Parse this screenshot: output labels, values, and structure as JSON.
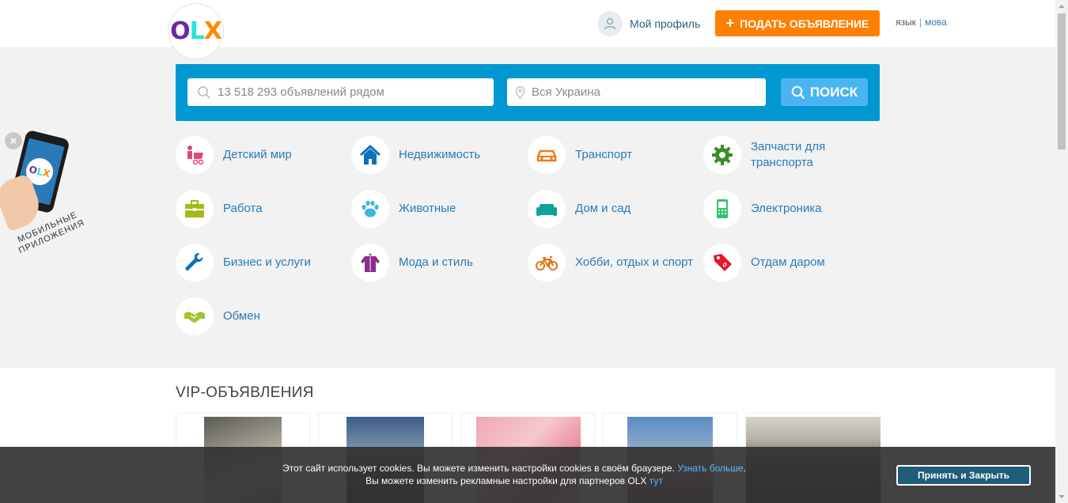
{
  "header": {
    "logo": {
      "o": "O",
      "l": "L",
      "x": "X"
    },
    "profile_label": "Мой профиль",
    "post_button": "ПОДАТЬ ОБЪЯВЛЕНИЕ",
    "lang_current": "язык",
    "lang_separator": "|",
    "lang_alt": "мова"
  },
  "search": {
    "placeholder": "13 518 293 объявлений рядом",
    "location_placeholder": "Вся Украина",
    "button_label": "ПОИСК"
  },
  "categories": [
    {
      "label": "Детский мир",
      "icon": "stroller-icon",
      "color": "#e0457b"
    },
    {
      "label": "Недвижимость",
      "icon": "house-icon",
      "color": "#0a72ba"
    },
    {
      "label": "Транспорт",
      "icon": "car-icon",
      "color": "#f07a15"
    },
    {
      "label": "Запчасти для транспорта",
      "icon": "gear-icon",
      "color": "#3c8c2c"
    },
    {
      "label": "Работа",
      "icon": "briefcase-icon",
      "color": "#a5b818"
    },
    {
      "label": "Животные",
      "icon": "paw-icon",
      "color": "#3ab6e6"
    },
    {
      "label": "Дом и сад",
      "icon": "sofa-icon",
      "color": "#0fa19a"
    },
    {
      "label": "Электроника",
      "icon": "phone-icon",
      "color": "#31c46b"
    },
    {
      "label": "Бизнес и услуги",
      "icon": "wrench-icon",
      "color": "#0a72ba"
    },
    {
      "label": "Мода и стиль",
      "icon": "clothes-icon",
      "color": "#8e2b8c"
    },
    {
      "label": "Хобби, отдых и спорт",
      "icon": "bicycle-icon",
      "color": "#e27613"
    },
    {
      "label": "Отдам даром",
      "icon": "price-tag-icon",
      "color": "#e4182d"
    },
    {
      "label": "Обмен",
      "icon": "handshake-icon",
      "color": "#a2c52f"
    }
  ],
  "app_promo": {
    "text_line1": "МОБИЛЬНЫЕ",
    "text_line2": "ПРИЛОЖЕНИЯ",
    "close": "×"
  },
  "vip": {
    "title": "VIP-ОБЪЯВЛЕНИЯ",
    "cards": [
      {
        "image": "baby-clothes-photo",
        "color": "#a09a88"
      },
      {
        "image": "office-interior-photo",
        "color": "#3f4d6a"
      },
      {
        "image": "gift-box-photo",
        "color": "#f0a6b5"
      },
      {
        "image": "girl-dress-photo",
        "color": "#5a8cc8"
      },
      {
        "image": "thermos-bottles-photo",
        "color": "#5e5a55"
      }
    ]
  },
  "cookie": {
    "line1_text": "Этот сайт использует cookies. Вы можете изменить настройки cookies в своём браузере.",
    "line1_link": "Узнать больше",
    "line1_end": ".",
    "line2_text": "Вы можете изменить рекламные настройки для партнеров OLX",
    "line2_link": "тут",
    "accept_button": "Принять и Закрыть"
  },
  "colors": {
    "accent": "#ff7f00",
    "search_panel": "#0098d0",
    "link": "#2a7ab8"
  }
}
